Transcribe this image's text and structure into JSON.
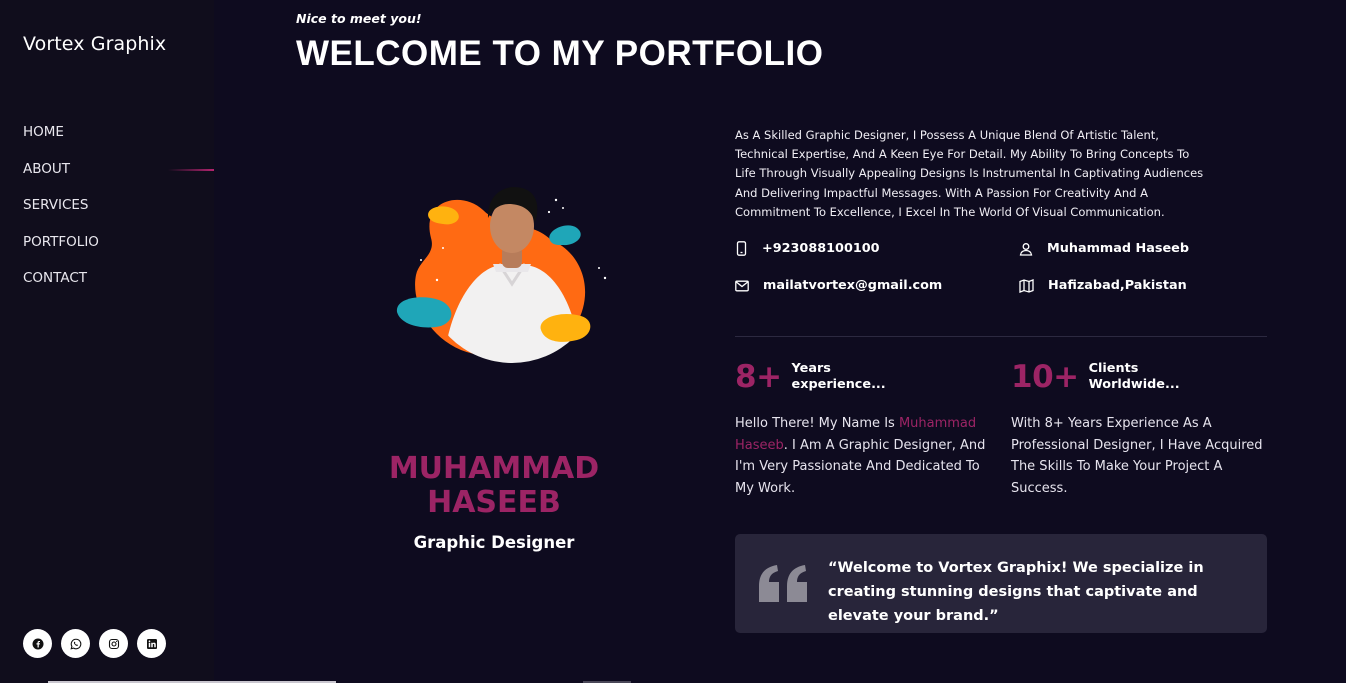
{
  "sidebar": {
    "brand": "Vortex Graphix",
    "nav": [
      {
        "label": "HOME"
      },
      {
        "label": "ABOUT"
      },
      {
        "label": "SERVICES"
      },
      {
        "label": "PORTFOLIO"
      },
      {
        "label": "CONTACT"
      }
    ],
    "active_item": "ABOUT",
    "socials": [
      "facebook-icon",
      "whatsapp-icon",
      "instagram-icon",
      "linkedin-icon"
    ]
  },
  "hero": {
    "greeting": "Nice to meet you!",
    "headline": "WELCOME TO MY PORTFOLIO"
  },
  "profile": {
    "name": "MUHAMMAD HASEEB",
    "role": "Graphic Designer"
  },
  "about": {
    "bio": "As A Skilled Graphic Designer, I Possess A Unique Blend Of Artistic Talent, Technical Expertise, And A Keen Eye For Detail. My Ability To Bring Concepts To Life Through Visually Appealing Designs Is Instrumental In Captivating Audiences And Delivering Impactful Messages. With A Passion For Creativity And A Commitment To Excellence, I Excel In The World Of Visual Communication.",
    "phone": "+923088100100",
    "owner": "Muhammad Haseeb",
    "email": "mailatvortex@gmail.com",
    "location": "Hafizabad,Pakistan"
  },
  "stats": [
    {
      "number": "8+",
      "label_line1": "Years",
      "label_line2": "experience..."
    },
    {
      "number": "10+",
      "label_line1": "Clients",
      "label_line2": "Worldwide..."
    }
  ],
  "intro": {
    "before": "Hello There! My Name Is ",
    "highlight": "Muhammad Haseeb",
    "after": ". I Am A Graphic Designer, And I'm Very Passionate And Dedicated To My Work."
  },
  "experience_text": "With 8+ Years Experience As A Professional Designer, I Have Acquired The Skills To Make Your Project A Success.",
  "quote": "“Welcome to Vortex Graphix! We specialize in creating stunning designs that captivate and elevate your brand.”",
  "colors": {
    "accent": "#9c2465",
    "background": "#0e0b1f",
    "sidebar": "#100d1c",
    "quote_box": "#28253a"
  }
}
